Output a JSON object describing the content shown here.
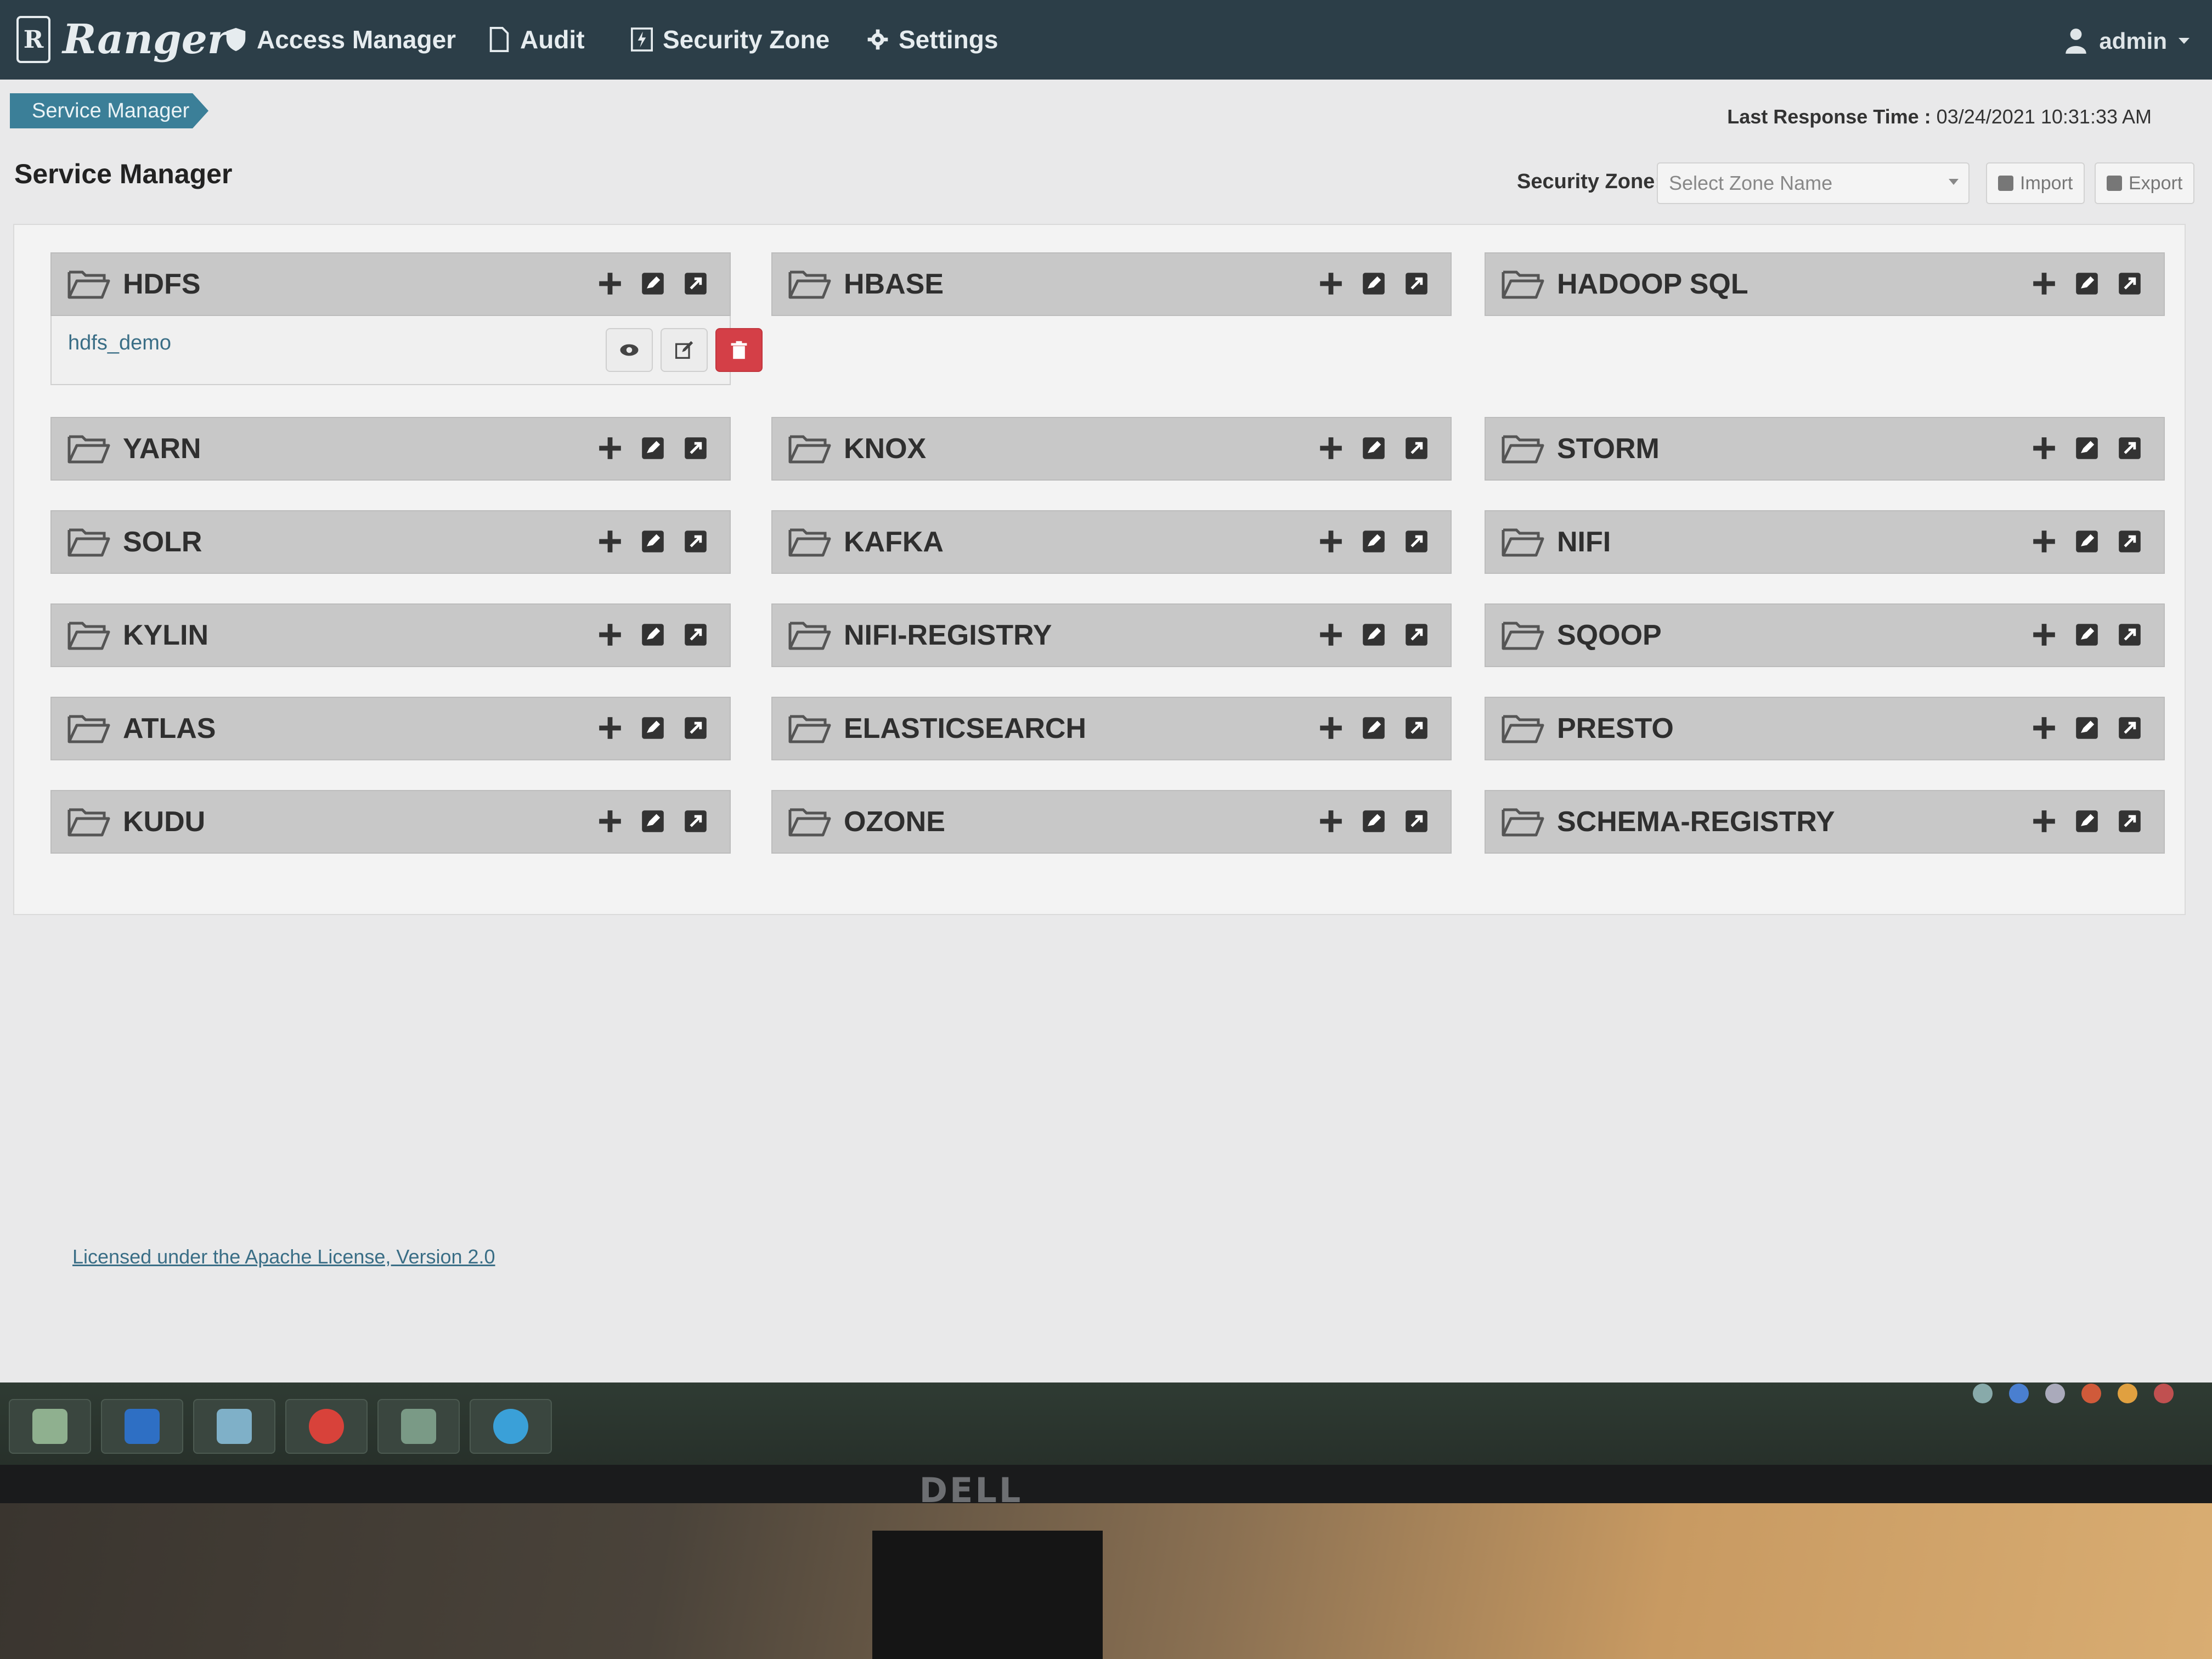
{
  "app": {
    "logo_mark": "R",
    "logo_text": "Ranger",
    "nav": [
      {
        "label": "Access Manager",
        "icon": "shield-icon"
      },
      {
        "label": "Audit",
        "icon": "file-icon"
      },
      {
        "label": "Security Zone",
        "icon": "zone-icon"
      },
      {
        "label": "Settings",
        "icon": "gear-icon"
      }
    ],
    "user": "admin"
  },
  "breadcrumb": "Service Manager",
  "last_response": {
    "label": "Last Response Time :",
    "value": "03/24/2021 10:31:33 AM"
  },
  "page_title": "Service Manager",
  "security_zone": {
    "label": "Security Zone:",
    "placeholder": "Select Zone Name"
  },
  "buttons": {
    "import": "Import",
    "export": "Export"
  },
  "services": [
    {
      "name": "HDFS",
      "items": [
        "hdfs_demo"
      ]
    },
    {
      "name": "HBASE",
      "items": []
    },
    {
      "name": "HADOOP SQL",
      "items": []
    },
    {
      "name": "YARN",
      "items": []
    },
    {
      "name": "KNOX",
      "items": []
    },
    {
      "name": "STORM",
      "items": []
    },
    {
      "name": "SOLR",
      "items": []
    },
    {
      "name": "KAFKA",
      "items": []
    },
    {
      "name": "NIFI",
      "items": []
    },
    {
      "name": "KYLIN",
      "items": []
    },
    {
      "name": "NIFI-REGISTRY",
      "items": []
    },
    {
      "name": "SQOOP",
      "items": []
    },
    {
      "name": "ATLAS",
      "items": []
    },
    {
      "name": "ELASTICSEARCH",
      "items": []
    },
    {
      "name": "PRESTO",
      "items": []
    },
    {
      "name": "KUDU",
      "items": []
    },
    {
      "name": "OZONE",
      "items": []
    },
    {
      "name": "SCHEMA-REGISTRY",
      "items": []
    }
  ],
  "footer": {
    "license": "Licensed under the Apache License, Version 2.0"
  },
  "monitor_brand": "DELL",
  "colors": {
    "topnav": "#2c3e48",
    "breadcrumb": "#3b7f98",
    "service_header": "#c8c8c8",
    "delete": "#d43f47",
    "link": "#3a6e86"
  }
}
